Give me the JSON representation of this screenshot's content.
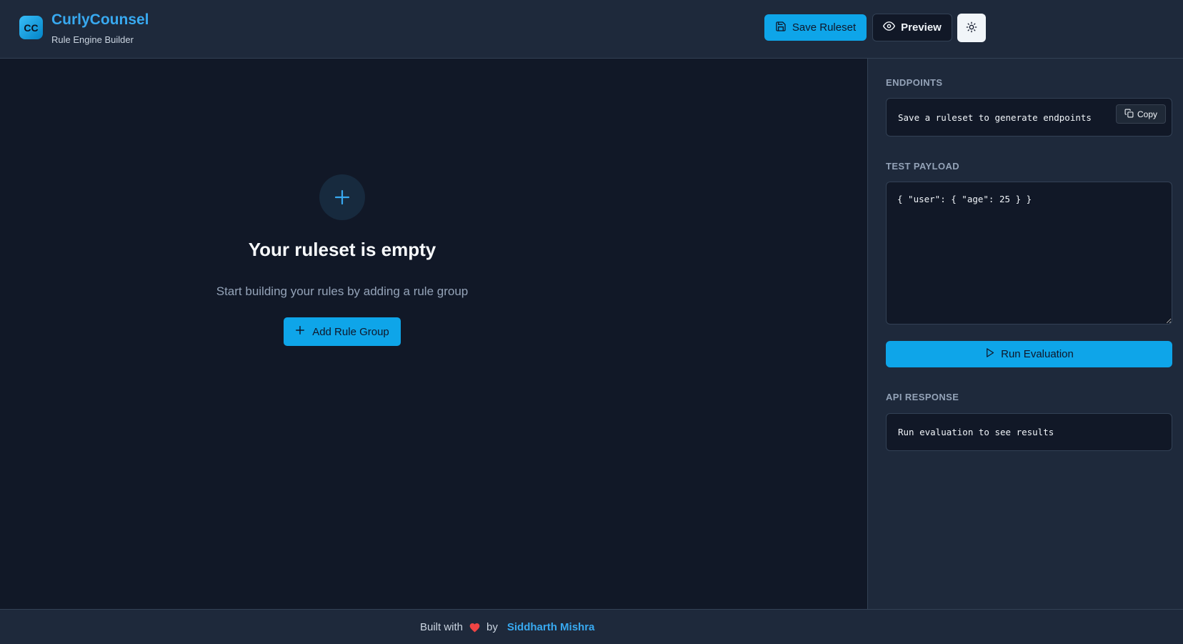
{
  "header": {
    "logo_text": "CC",
    "title": "CurlyCounsel",
    "subtitle": "Rule Engine Builder",
    "save_label": "Save Ruleset",
    "preview_label": "Preview"
  },
  "empty_state": {
    "title": "Your ruleset is empty",
    "description": "Start building your rules by adding a rule group",
    "add_label": "Add Rule Group"
  },
  "sidebar": {
    "endpoints_label": "ENDPOINTS",
    "endpoints_text": "Save a ruleset to generate endpoints",
    "copy_label": "Copy",
    "payload_label": "TEST PAYLOAD",
    "payload_value": "{ \"user\": { \"age\": 25 } }",
    "run_label": "Run Evaluation",
    "response_label": "API RESPONSE",
    "response_text": "Run evaluation to see results"
  },
  "footer": {
    "built_with": "Built with",
    "by": "by",
    "author": "Siddharth Mishra"
  },
  "colors": {
    "accent": "#0ea5e9",
    "brand": "#38a9f0",
    "heart": "#ef4444",
    "background": "#111827",
    "panel": "#1e293b"
  },
  "icons": {
    "save": "save-icon",
    "preview": "eye-icon",
    "theme": "sun-icon",
    "add": "plus-icon",
    "copy": "copy-icon",
    "run": "play-icon",
    "heart": "heart-icon"
  }
}
